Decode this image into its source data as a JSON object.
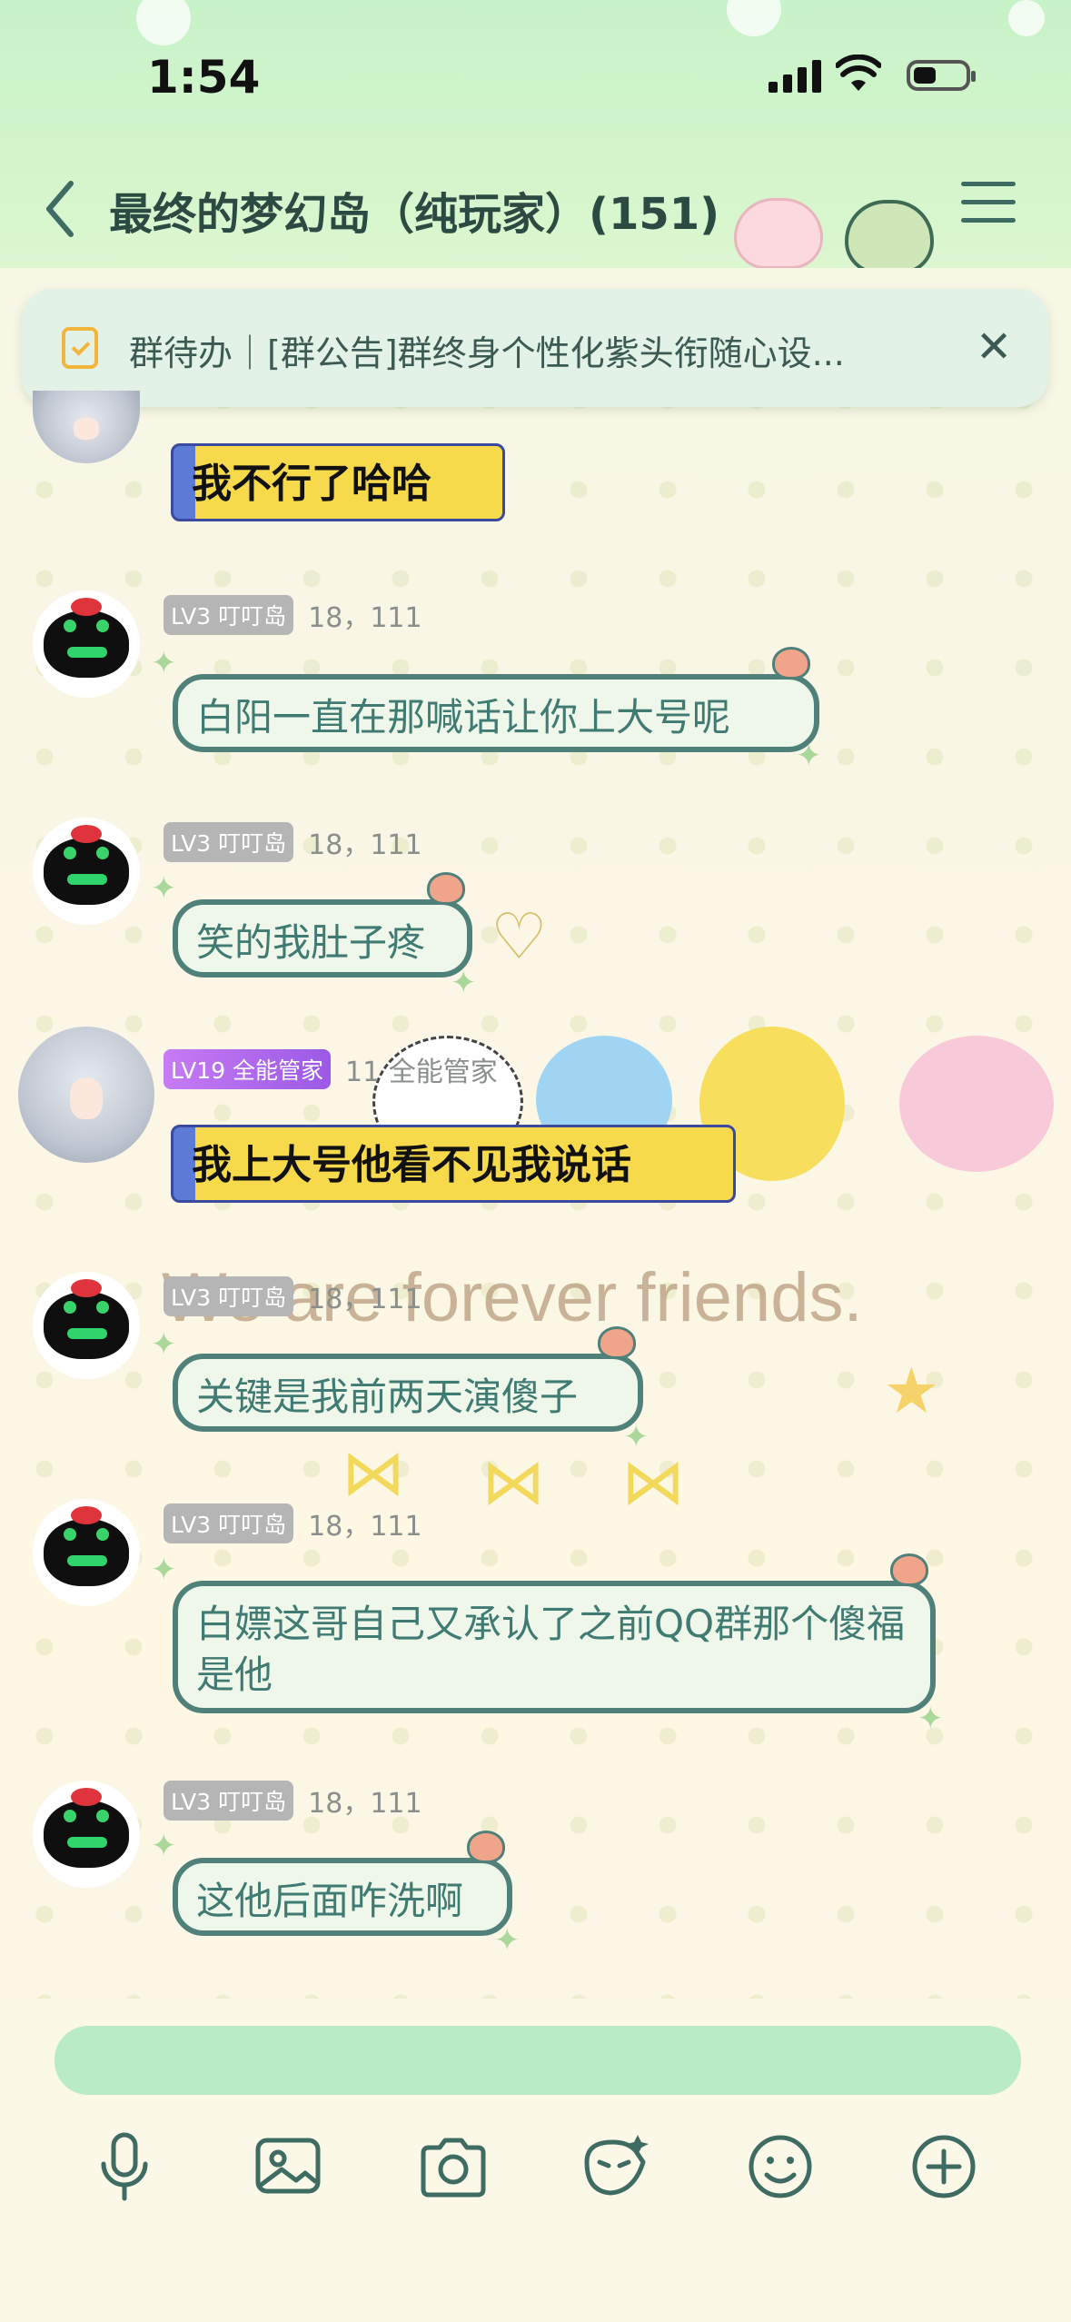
{
  "status": {
    "time": "1:54"
  },
  "header": {
    "title": "最终的梦幻岛（纯玩家）(151)"
  },
  "notice": {
    "text": "群待办｜[群公告]群终身个性化紫头衔随心设..."
  },
  "messages": [
    {
      "kind": "ribbon",
      "text": "我不行了哈哈"
    },
    {
      "level": "LV3 叮叮岛",
      "nick": "18，111",
      "text": "白阳一直在那喊话让你上大号呢"
    },
    {
      "level": "LV3 叮叮岛",
      "nick": "18，111",
      "text": "笑的我肚子疼"
    },
    {
      "level": "LV19 全能管家",
      "nick": "11 全能管家",
      "kind": "ribbon",
      "text": "我上大号他看不见我说话"
    },
    {
      "level": "LV3 叮叮岛",
      "nick": "18，111",
      "text": "关键是我前两天演傻子"
    },
    {
      "level": "LV3 叮叮岛",
      "nick": "18，111",
      "text": "白嫖这哥自己又承认了之前QQ群那个傻福是他"
    },
    {
      "level": "LV3 叮叮岛",
      "nick": "18，111",
      "text": "这他后面咋洗啊"
    }
  ],
  "decor": {
    "banner_text": "We are forever friends."
  },
  "input": {
    "value": ""
  },
  "toolbar_icons": [
    "microphone-icon",
    "image-icon",
    "camera-icon",
    "sticker-icon",
    "emoji-icon",
    "plus-icon"
  ],
  "colors": {
    "accent": "#4f807a",
    "bubble_bg": "#eef7ea",
    "input_bg": "#b9ecc4",
    "header_bg": "#c8f2c8"
  }
}
